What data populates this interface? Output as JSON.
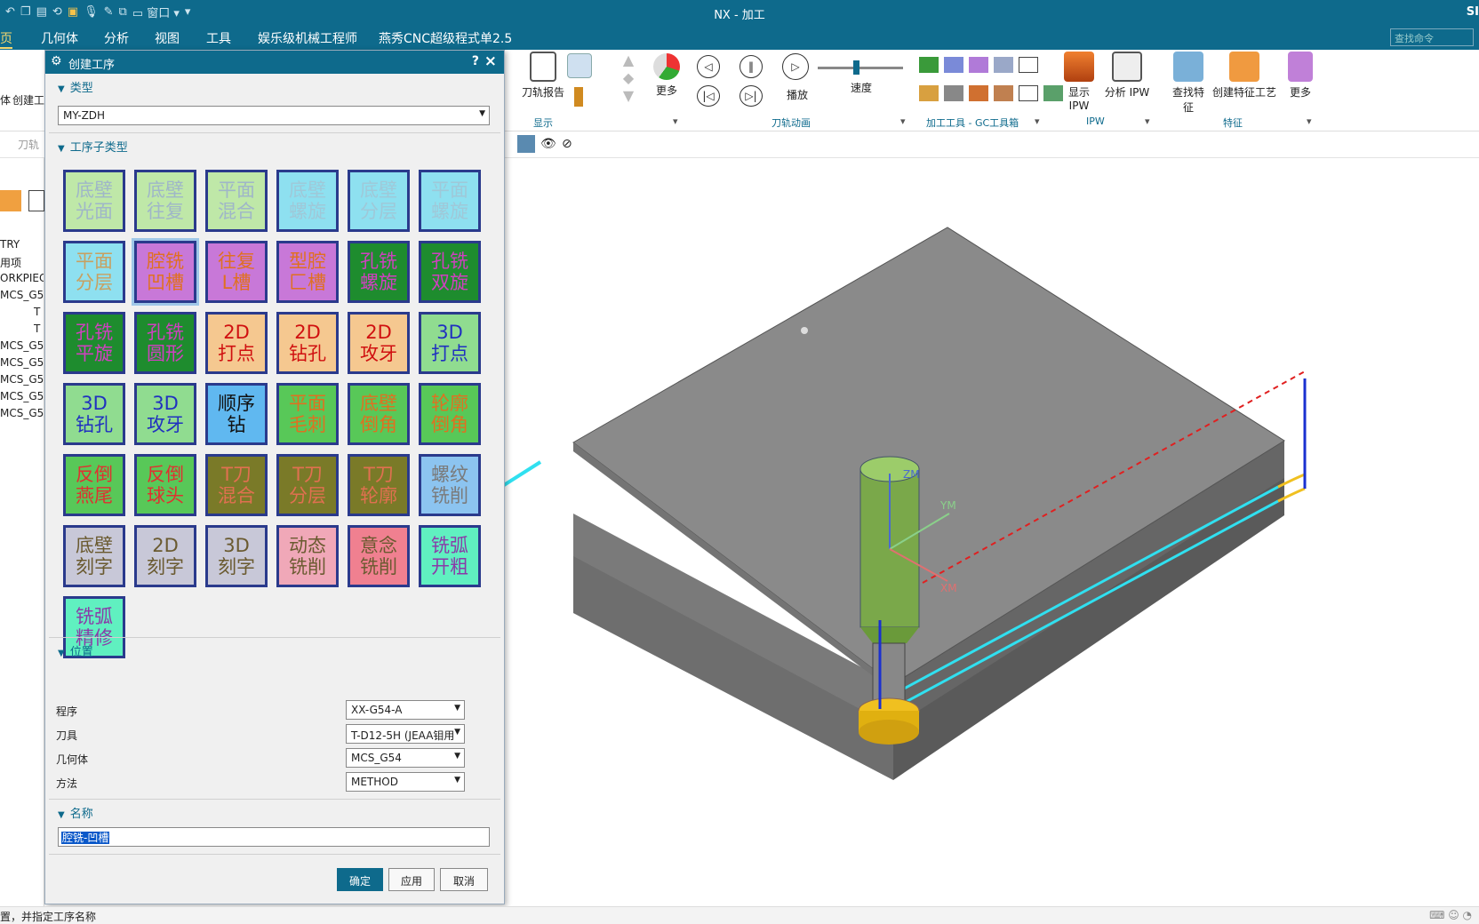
{
  "window": {
    "title": "NX - 加工",
    "brand": "SI"
  },
  "quick_access": {
    "window_menu": "窗口"
  },
  "menu": {
    "items": [
      "页",
      "几何体",
      "分析",
      "视图",
      "工具",
      "娱乐级机械工程师",
      "燕秀CNC超级程式单2.5"
    ],
    "search_placeholder": "查找命令"
  },
  "ribbon": {
    "left_labels": [
      "体",
      "创建工"
    ],
    "display": {
      "items": [
        "刀轨报告",
        "更多"
      ],
      "group": "显示"
    },
    "animation": {
      "play": "播放",
      "speed": "速度",
      "group": "刀轨动画"
    },
    "gc_group": "加工工具 - GC工具箱",
    "ipw": {
      "show": "显示 IPW",
      "analyze": "分析 IPW",
      "group": "IPW"
    },
    "features": {
      "find": "查找特征",
      "create": "创建特征工艺",
      "more": "更多",
      "group": "特征"
    }
  },
  "toolbar2": {
    "toolpath_label": "刀轨"
  },
  "nav_tree": {
    "items": [
      "TRY",
      "用项",
      "ORKPIEC",
      "MCS_G5",
      "T",
      "T",
      "MCS_G5",
      "MCS_G5",
      "MCS_G5",
      "MCS_G5",
      "MCS_G5"
    ]
  },
  "dialog": {
    "title": "创建工序",
    "help": "?",
    "type_section": "类型",
    "type_value": "MY-ZDH",
    "subtype_section": "工序子类型",
    "tiles": [
      {
        "label": "底壁光面",
        "bg": "#bfe8a8",
        "fg": "#9fb6c8"
      },
      {
        "label": "底壁往复",
        "bg": "#bfe8a8",
        "fg": "#9fb6c8"
      },
      {
        "label": "平面混合",
        "bg": "#bfe8a8",
        "fg": "#9fb6c8"
      },
      {
        "label": "底壁螺旋",
        "bg": "#8ee0f0",
        "fg": "#9fc8d8"
      },
      {
        "label": "底壁分层",
        "bg": "#8ee0f0",
        "fg": "#9fc8d8"
      },
      {
        "label": "平面螺旋",
        "bg": "#8ee0f0",
        "fg": "#9fc8d8"
      },
      {
        "label": "平面分层",
        "bg": "#8ee0f0",
        "fg": "#c8a060"
      },
      {
        "label": "腔铣凹槽",
        "bg": "#c878d8",
        "fg": "#e07020"
      },
      {
        "label": "往复L槽",
        "bg": "#c878d8",
        "fg": "#e07020"
      },
      {
        "label": "型腔匚槽",
        "bg": "#c878d8",
        "fg": "#e07020"
      },
      {
        "label": "孔铣螺旋",
        "bg": "#1e8c2e",
        "fg": "#d040c0"
      },
      {
        "label": "孔铣双旋",
        "bg": "#1e8c2e",
        "fg": "#d040c0"
      },
      {
        "label": "孔铣平旋",
        "bg": "#1e8c2e",
        "fg": "#d040c0"
      },
      {
        "label": "孔铣圆形",
        "bg": "#1e8c2e",
        "fg": "#d040c0"
      },
      {
        "label": "2D打点",
        "bg": "#f5c890",
        "fg": "#d01010"
      },
      {
        "label": "2D钻孔",
        "bg": "#f5c890",
        "fg": "#d01010"
      },
      {
        "label": "2D攻牙",
        "bg": "#f5c890",
        "fg": "#d01010"
      },
      {
        "label": "3D打点",
        "bg": "#90dc90",
        "fg": "#2030c0"
      },
      {
        "label": "3D钻孔",
        "bg": "#90dc90",
        "fg": "#2030c0"
      },
      {
        "label": "3D攻牙",
        "bg": "#90dc90",
        "fg": "#2030c0"
      },
      {
        "label": "顺序钻",
        "bg": "#60b8f0",
        "fg": "#111111"
      },
      {
        "label": "平面毛刺",
        "bg": "#58c858",
        "fg": "#e07020"
      },
      {
        "label": "底壁倒角",
        "bg": "#58c858",
        "fg": "#e07020"
      },
      {
        "label": "轮廓倒角",
        "bg": "#58c858",
        "fg": "#e07020"
      },
      {
        "label": "反倒燕尾",
        "bg": "#58c858",
        "fg": "#e03030"
      },
      {
        "label": "反倒球头",
        "bg": "#58c858",
        "fg": "#e03030"
      },
      {
        "label": "T刀混合",
        "bg": "#7a7a28",
        "fg": "#e07050"
      },
      {
        "label": "T刀分层",
        "bg": "#7a7a28",
        "fg": "#e07050"
      },
      {
        "label": "T刀轮廓",
        "bg": "#7a7a28",
        "fg": "#e07050"
      },
      {
        "label": "螺纹铣削",
        "bg": "#8cc4f0",
        "fg": "#7a7a7a"
      },
      {
        "label": "底壁刻字",
        "bg": "#c8c8d8",
        "fg": "#6a5a30"
      },
      {
        "label": "2D刻字",
        "bg": "#c8c8d8",
        "fg": "#6a5a30"
      },
      {
        "label": "3D刻字",
        "bg": "#c8c8d8",
        "fg": "#6a5a30"
      },
      {
        "label": "动态铣削",
        "bg": "#f0a8b8",
        "fg": "#6a5a30"
      },
      {
        "label": "意念铣削",
        "bg": "#f08090",
        "fg": "#6a5a30"
      },
      {
        "label": "铣弧开粗",
        "bg": "#60f0c0",
        "fg": "#8a3aa8"
      },
      {
        "label": "铣弧精修",
        "bg": "#60f0c0",
        "fg": "#8a3aa8"
      }
    ],
    "position_section": "位置",
    "fields": [
      {
        "label": "程序",
        "value": "XX-G54-A"
      },
      {
        "label": "刀具",
        "value": "T-D12-5H (JEAA钼用"
      },
      {
        "label": "几何体",
        "value": "MCS_G54"
      },
      {
        "label": "方法",
        "value": "METHOD"
      }
    ],
    "name_section": "名称",
    "name_value": "腔铣-凹槽",
    "ok": "确定",
    "apply": "应用",
    "cancel": "取消"
  },
  "viewport": {
    "axis_z": "ZM",
    "axis_y": "YM",
    "axis_x": "XM"
  },
  "status": {
    "text": "置，并指定工序名称"
  }
}
